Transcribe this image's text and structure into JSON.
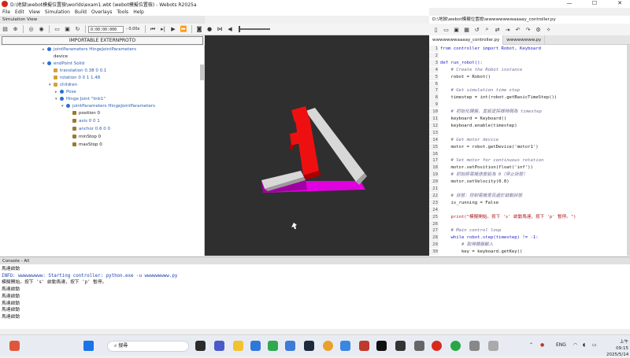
{
  "window": {
    "title": "D:\\地獄\\webot模擬位置檢\\worlds\\exam1.wbt (webot模擬位置檢) - Webots R2025a",
    "controls": [
      "—",
      "☐",
      "✕"
    ]
  },
  "menu": [
    "File",
    "Edit",
    "View",
    "Simulation",
    "Build",
    "Overlays",
    "Tools",
    "Help"
  ],
  "simulation_view": {
    "header": "Simulation View",
    "time": "0:00:00:000",
    "speed": "- 0.00x"
  },
  "scene_tree": {
    "proto_button": "IMPORTABLE EXTERNPROTO",
    "items": [
      {
        "label": "jointParameters HingeJointParameters",
        "color": "blue",
        "arrow": "▸",
        "icon": "dot"
      },
      {
        "label": "device",
        "color": "black",
        "arrow": "",
        "icon": "none"
      },
      {
        "label": "endPoint Solid",
        "color": "blue",
        "arrow": "▾",
        "icon": "dot"
      },
      {
        "label": "translation 0.38 0 0.1",
        "color": "blue",
        "arrow": "",
        "icon": "fld"
      },
      {
        "label": "rotation 0 0 1 1.48",
        "color": "blue",
        "arrow": "",
        "icon": "fld"
      },
      {
        "label": "children",
        "color": "blue",
        "arrow": "▾",
        "icon": "fld"
      },
      {
        "label": "Pose",
        "color": "blue",
        "arrow": "▸",
        "icon": "dot"
      },
      {
        "label": "Hinge Joint \"link1\"",
        "color": "blue",
        "arrow": "▾",
        "icon": "dot"
      },
      {
        "label": "jointParameters HingeJointParameters",
        "color": "blue",
        "arrow": "▾",
        "icon": "dot"
      },
      {
        "label": "position 0",
        "color": "black",
        "arrow": "",
        "icon": "leaf"
      },
      {
        "label": "axis 0 0 1",
        "color": "blue",
        "arrow": "",
        "icon": "leaf"
      },
      {
        "label": "anchor 0.6 0 0",
        "color": "blue",
        "arrow": "",
        "icon": "leaf"
      },
      {
        "label": "minStop 0",
        "color": "black",
        "arrow": "",
        "icon": "leaf"
      },
      {
        "label": "maxStop 0",
        "color": "black",
        "arrow": "",
        "icon": "leaf"
      }
    ]
  },
  "editor": {
    "title": "D:\\地獄\\webot模擬位置檢\\wwwwwwwwaaaay_controller.py",
    "tabs": [
      "wwwwwwwaaaay_controller.py",
      "wwwwwwww.py"
    ],
    "lines": [
      {
        "n": "1",
        "t": "from controller import Robot, Keyboard",
        "c": "k"
      },
      {
        "n": "2",
        "t": "",
        "c": "p"
      },
      {
        "n": "3",
        "t": "def run_robot():",
        "c": "k"
      },
      {
        "n": "4",
        "t": "    # Create the Robot instance",
        "c": "c"
      },
      {
        "n": "5",
        "t": "    robot = Robot()",
        "c": "p"
      },
      {
        "n": "6",
        "t": "",
        "c": "p"
      },
      {
        "n": "7",
        "t": "    # Get simulation time step",
        "c": "c"
      },
      {
        "n": "8",
        "t": "    timestep = int(robot.getBasicTimeStep())",
        "c": "p"
      },
      {
        "n": "9",
        "t": "",
        "c": "p"
      },
      {
        "n": "10",
        "t": "    # 初始化鍵盤，並設定採樣時間為 timestep",
        "c": "c"
      },
      {
        "n": "11",
        "t": "    keyboard = Keyboard()",
        "c": "p"
      },
      {
        "n": "12",
        "t": "    keyboard.enable(timestep)",
        "c": "p"
      },
      {
        "n": "13",
        "t": "",
        "c": "p"
      },
      {
        "n": "14",
        "t": "    # Get motor device",
        "c": "c"
      },
      {
        "n": "15",
        "t": "    motor = robot.getDevice('motor1')",
        "c": "p"
      },
      {
        "n": "16",
        "t": "",
        "c": "p"
      },
      {
        "n": "17",
        "t": "    # Set motor for continuous rotation",
        "c": "c"
      },
      {
        "n": "18",
        "t": "    motor.setPosition(float('inf'))",
        "c": "p"
      },
      {
        "n": "19",
        "t": "    # 初始將電機速度設為 0（停止狀態）",
        "c": "c"
      },
      {
        "n": "20",
        "t": "    motor.setVelocity(0.0)",
        "c": "p"
      },
      {
        "n": "21",
        "t": "",
        "c": "p"
      },
      {
        "n": "22",
        "t": "    # 狀態：控制電機是否處於啟動狀態",
        "c": "c"
      },
      {
        "n": "23",
        "t": "    is_running = False",
        "c": "p"
      },
      {
        "n": "24",
        "t": "",
        "c": "p"
      },
      {
        "n": "25",
        "t": "    print(\"模擬開始。按下 's' 啟動馬達，按下 'p' 暫停。\")",
        "c": "s"
      },
      {
        "n": "26",
        "t": "",
        "c": "p"
      },
      {
        "n": "27",
        "t": "    # Main control loop",
        "c": "c"
      },
      {
        "n": "28",
        "t": "    while robot.step(timestep) != -1:",
        "c": "k"
      },
      {
        "n": "29",
        "t": "        # 取得鍵盤輸入",
        "c": "c"
      },
      {
        "n": "30",
        "t": "        key = keyboard.getKey()",
        "c": "p"
      }
    ]
  },
  "console": {
    "header": "Console - All",
    "lines": [
      {
        "t": "馬達啟動",
        "c": "p"
      },
      {
        "t": "INFO: wwwwwwwww: Starting controller: python.exe -u wwwwwwwww.py",
        "c": "info"
      },
      {
        "t": "模擬開始。按下 's' 啟動馬達，按下 'p' 暫停。",
        "c": "p"
      },
      {
        "t": "馬達啟動",
        "c": "p"
      },
      {
        "t": "馬達啟動",
        "c": "p"
      },
      {
        "t": "馬達啟動",
        "c": "p"
      },
      {
        "t": "馬達啟動",
        "c": "p"
      },
      {
        "t": "馬達啟動",
        "c": "p"
      }
    ]
  },
  "taskbar": {
    "search_placeholder": "搜尋",
    "lang": "ENG",
    "time": "上午 09:15",
    "date": "2025/5/14"
  }
}
